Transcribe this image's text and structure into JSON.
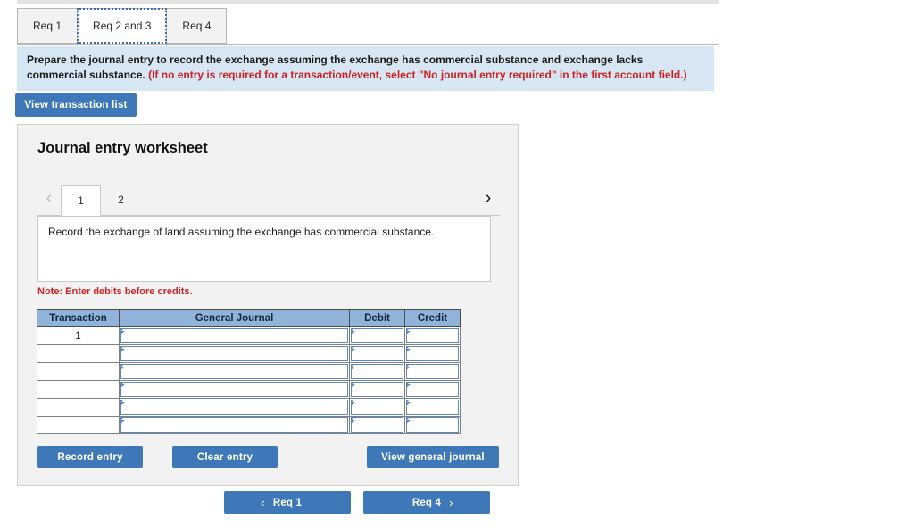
{
  "tabs": [
    {
      "label": "Req 1",
      "active": false
    },
    {
      "label": "Req 2 and 3",
      "active": true
    },
    {
      "label": "Req 4",
      "active": false
    }
  ],
  "instruction": {
    "main": "Prepare the journal entry to record the exchange assuming the exchange has commercial substance and exchange lacks commercial substance.",
    "hint": "(If no entry is required for a transaction/event, select \"No journal entry required\" in the first account field.)"
  },
  "toolbar": {
    "view_transaction_list": "View transaction list"
  },
  "worksheet": {
    "title": "Journal entry worksheet",
    "pager": {
      "prev_icon": "chevron-left",
      "next_icon": "chevron-right",
      "pages": [
        "1",
        "2"
      ],
      "active_page": "1"
    },
    "description": "Record the exchange of land assuming the exchange has commercial substance.",
    "note": "Note: Enter debits before credits.",
    "table": {
      "headers": [
        "Transaction",
        "General Journal",
        "Debit",
        "Credit"
      ],
      "rows": [
        {
          "transaction": "1",
          "general_journal": "",
          "debit": "",
          "credit": ""
        },
        {
          "transaction": "",
          "general_journal": "",
          "debit": "",
          "credit": ""
        },
        {
          "transaction": "",
          "general_journal": "",
          "debit": "",
          "credit": ""
        },
        {
          "transaction": "",
          "general_journal": "",
          "debit": "",
          "credit": ""
        },
        {
          "transaction": "",
          "general_journal": "",
          "debit": "",
          "credit": ""
        },
        {
          "transaction": "",
          "general_journal": "",
          "debit": "",
          "credit": ""
        }
      ]
    },
    "buttons": {
      "record_entry": "Record entry",
      "clear_entry": "Clear entry",
      "view_general_journal": "View general journal"
    }
  },
  "bottom_nav": {
    "prev_label": "Req 1",
    "prev_icon": "chevron-left",
    "next_label": "Req 4",
    "next_icon": "chevron-right"
  },
  "colors": {
    "primary_blue": "#3e78b8",
    "banner_blue": "#d6e7f3",
    "table_header_blue": "#8fb3d9",
    "field_border_blue": "#5b89bd",
    "red_text": "#cc2222",
    "panel_gray": "#f2f2f2"
  }
}
